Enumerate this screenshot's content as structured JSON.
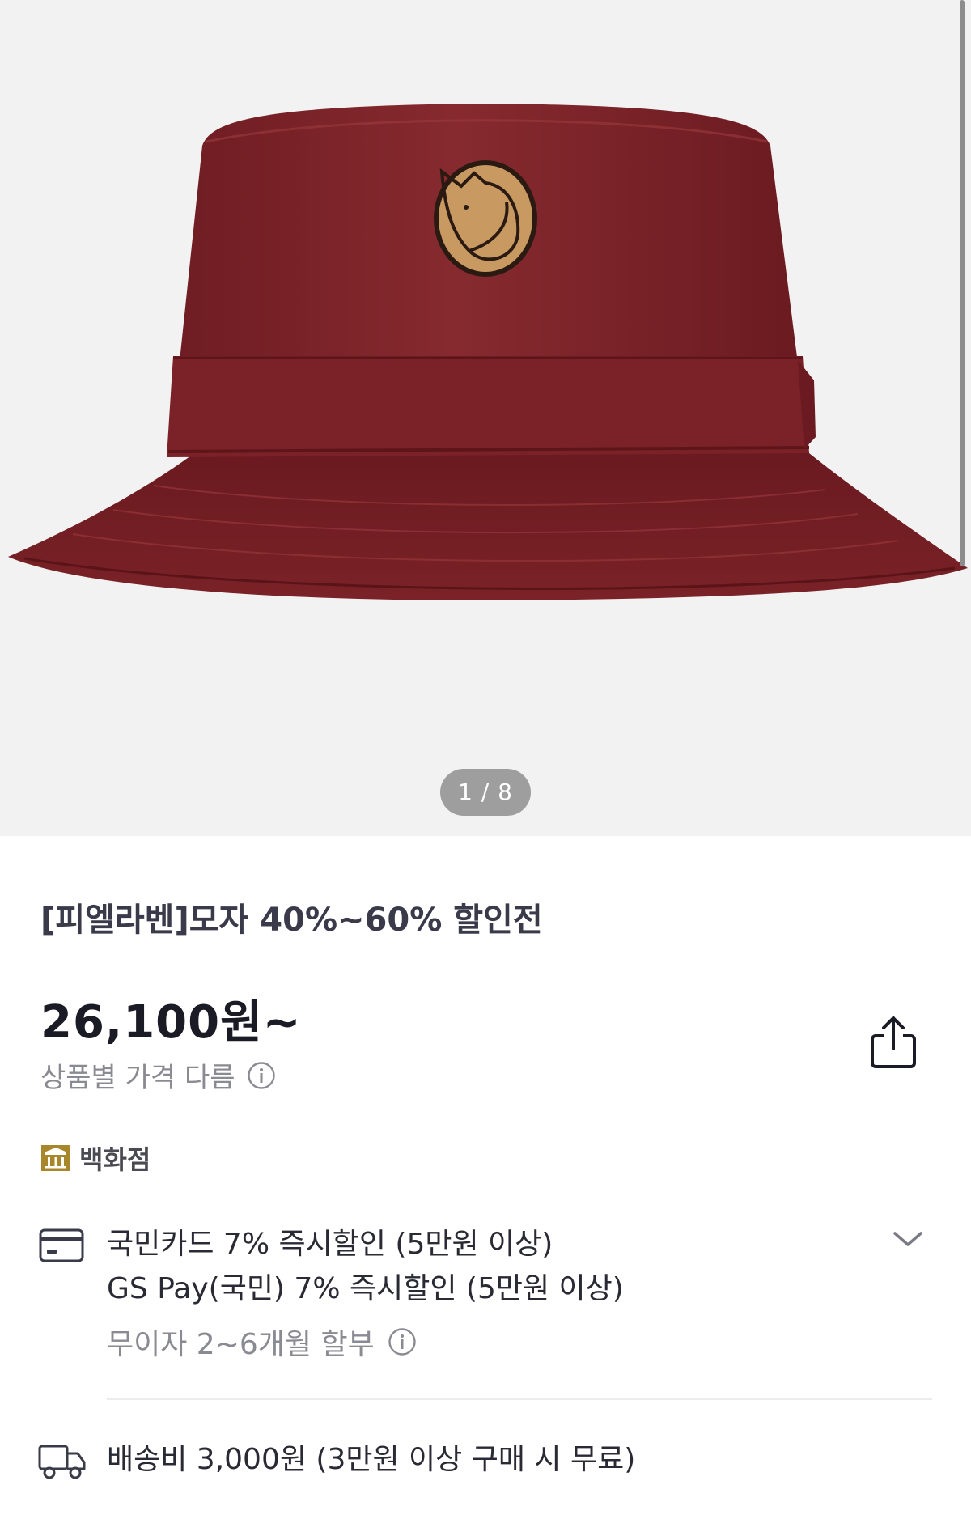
{
  "gallery": {
    "counter": "1 / 8",
    "image_subject": "bucket-hat",
    "hat_color": "#7e2228"
  },
  "product": {
    "title": "[피엘라벤]모자 40%~60% 할인전",
    "price": "26,100원~",
    "price_note": "상품별 가격 다름",
    "store_label": "백화점"
  },
  "payment": {
    "line1": "국민카드 7% 즉시할인 (5만원 이상)",
    "line2": "GS Pay(국민) 7% 즉시할인 (5만원 이상)",
    "installment": "무이자 2~6개월 할부"
  },
  "shipping": {
    "text": "배송비 3,000원 (3만원 이상 구매 시 무료)"
  },
  "icons": {
    "share": "share-icon",
    "info": "info-icon",
    "store": "department-store-icon",
    "card": "credit-card-icon",
    "chevron": "chevron-down-icon",
    "truck": "delivery-truck-icon"
  },
  "colors": {
    "hero_bg": "#f2f2f2",
    "counter_bg": "#9e9e9e",
    "store_icon": "#a8862a"
  }
}
